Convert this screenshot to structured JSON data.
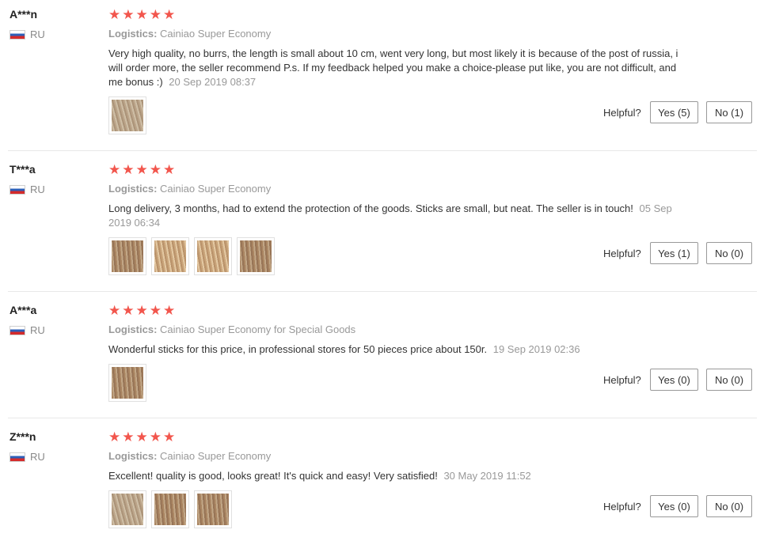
{
  "reviews": [
    {
      "user": "A***n",
      "country": "RU",
      "logistics_label": "Logistics:",
      "logistics_value": "Cainiao Super Economy",
      "comment": "Very high quality, no burrs, the length is small about 10 cm, went very long, but most likely it is because of the post of russia, i will order more, the seller recommend P.s. If my feedback helped you make a choice-please put like, you are not difficult, and me bonus :)",
      "date": "20 Sep 2019 08:37",
      "helpful_label": "Helpful?",
      "yes_label": "Yes (5)",
      "no_label": "No (1)"
    },
    {
      "user": "T***a",
      "country": "RU",
      "logistics_label": "Logistics:",
      "logistics_value": "Cainiao Super Economy",
      "comment": "Long delivery, 3 months, had to extend the protection of the goods. Sticks are small, but neat. The seller is in touch!",
      "date": "05 Sep 2019 06:34",
      "helpful_label": "Helpful?",
      "yes_label": "Yes (1)",
      "no_label": "No (0)"
    },
    {
      "user": "A***a",
      "country": "RU",
      "logistics_label": "Logistics:",
      "logistics_value": "Cainiao Super Economy for Special Goods",
      "comment": "Wonderful sticks for this price, in professional stores for 50 pieces price about 150r.",
      "date": "19 Sep 2019 02:36",
      "helpful_label": "Helpful?",
      "yes_label": "Yes (0)",
      "no_label": "No (0)"
    },
    {
      "user": "Z***n",
      "country": "RU",
      "logistics_label": "Logistics:",
      "logistics_value": "Cainiao Super Economy",
      "comment": "Excellent! quality is good, looks great! It's quick and easy! Very satisfied!",
      "date": "30 May 2019 11:52",
      "helpful_label": "Helpful?",
      "yes_label": "Yes (0)",
      "no_label": "No (0)"
    }
  ],
  "rating_stars": 5,
  "colors": {
    "star": "#f2564d",
    "muted_text": "#999999",
    "button_border": "#999999"
  }
}
